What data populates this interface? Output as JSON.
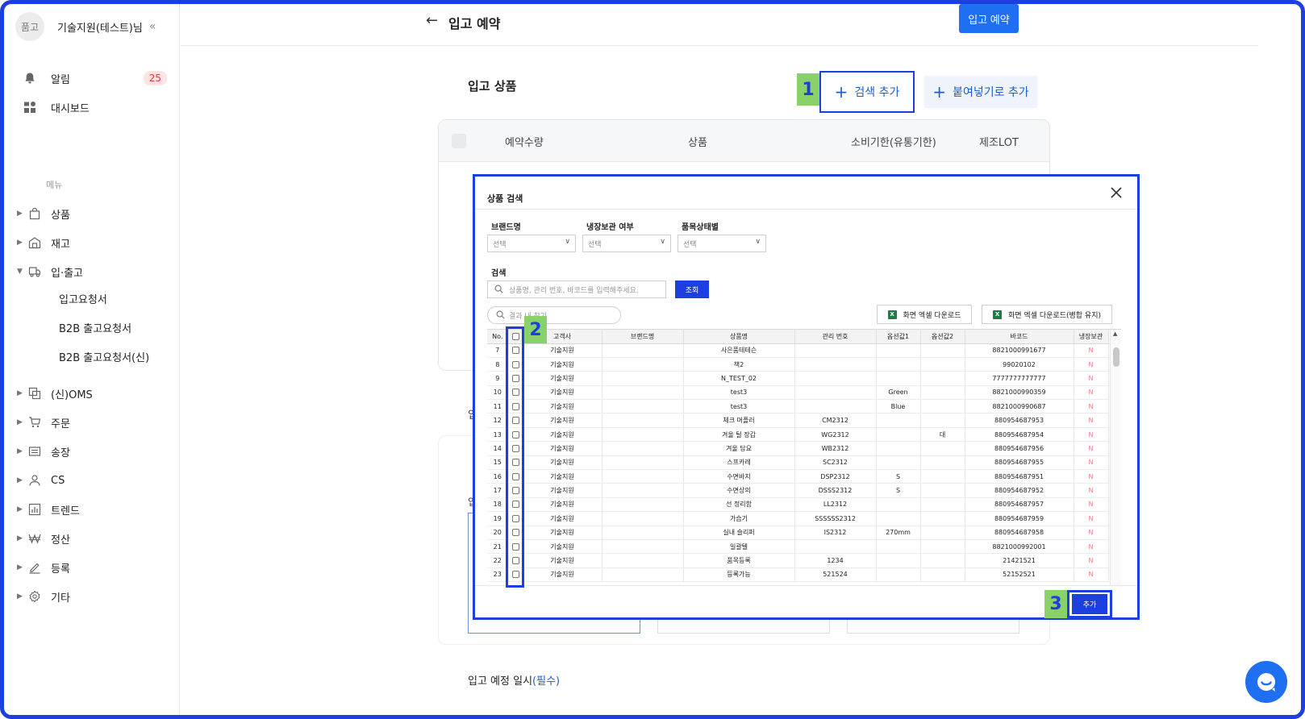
{
  "sidebar": {
    "avatar": "품고",
    "user_name": "기술지원(테스트)님",
    "collapse": "«",
    "top_items": [
      {
        "label": "알림",
        "icon": "bell-icon",
        "badge": "25"
      },
      {
        "label": "대시보드",
        "icon": "dashboard-icon"
      }
    ],
    "menu_label": "메뉴",
    "menu": [
      {
        "label": "상품",
        "icon": "bag-icon"
      },
      {
        "label": "재고",
        "icon": "warehouse-icon"
      },
      {
        "label": "입·출고",
        "icon": "truck-icon"
      },
      {
        "label": "(신)OMS",
        "icon": "oms-icon"
      },
      {
        "label": "주문",
        "icon": "cart-icon"
      },
      {
        "label": "송장",
        "icon": "invoice-icon"
      },
      {
        "label": "CS",
        "icon": "person-icon"
      },
      {
        "label": "트렌드",
        "icon": "chart-icon"
      },
      {
        "label": "정산",
        "icon": "won-icon"
      },
      {
        "label": "등록",
        "icon": "pen-icon"
      },
      {
        "label": "기타",
        "icon": "gear-icon"
      }
    ],
    "sub_items": [
      "입고요청서",
      "B2B 출고요청서",
      "B2B 출고요청서(신)"
    ]
  },
  "header": {
    "back": "←",
    "title": "입고 예약",
    "primary_button": "입고 예약"
  },
  "main": {
    "section_title": "입고 상품",
    "search_add": "검색 추가",
    "paste_add": "붙여넣기로 추가",
    "plus": "+",
    "table_headers": [
      "예약수량",
      "상품",
      "소비기한(유통기한)",
      "제조LOT"
    ],
    "bg_fragment_1": "입",
    "bg_fragment_2": "입",
    "due_label": "입고 예정 일시",
    "due_required": "(필수)"
  },
  "annotations": [
    "1",
    "2",
    "3"
  ],
  "modal": {
    "title": "상품 검색",
    "filters": [
      {
        "label": "브랜드명",
        "placeholder": "선택"
      },
      {
        "label": "냉장보관 여부",
        "placeholder": "선택"
      },
      {
        "label": "품목상태별",
        "placeholder": "선택"
      }
    ],
    "search_label": "검색",
    "search_placeholder": "상품명, 관리 번호, 바코드를 입력해주세요.",
    "query_button": "조회",
    "result_filter_placeholder": "결과 내 찾기",
    "excel_download": "화면 엑셀 다운로드",
    "excel_download_merged": "화면 엑셀 다운로드(병합 유지)",
    "excel_icon": "X",
    "columns": [
      "No.",
      "",
      "고객사",
      "브랜드명",
      "상품명",
      "관리 번호",
      "옵션값1",
      "옵션값2",
      "바코드",
      "냉장보관"
    ],
    "rows": [
      {
        "no": "7",
        "client": "기술지원",
        "brand": "",
        "name": "사은품테테슨",
        "code": "",
        "opt1": "",
        "opt2": "",
        "barcode": "8821000991677",
        "cold": "N"
      },
      {
        "no": "8",
        "client": "기술지원",
        "brand": "",
        "name": "책2",
        "code": "",
        "opt1": "",
        "opt2": "",
        "barcode": "99020102",
        "cold": "N"
      },
      {
        "no": "9",
        "client": "기술지원",
        "brand": "",
        "name": "N_TEST_02",
        "code": "",
        "opt1": "",
        "opt2": "",
        "barcode": "7777777777777",
        "cold": "N"
      },
      {
        "no": "10",
        "client": "기술지원",
        "brand": "",
        "name": "test3",
        "code": "",
        "opt1": "Green",
        "opt2": "",
        "barcode": "8821000990359",
        "cold": "N"
      },
      {
        "no": "11",
        "client": "기술지원",
        "brand": "",
        "name": "test3",
        "code": "",
        "opt1": "Blue",
        "opt2": "",
        "barcode": "8821000990687",
        "cold": "N"
      },
      {
        "no": "12",
        "client": "기술지원",
        "brand": "",
        "name": "체크 머플러",
        "code": "CM2312",
        "opt1": "",
        "opt2": "",
        "barcode": "880954687953",
        "cold": "N"
      },
      {
        "no": "13",
        "client": "기술지원",
        "brand": "",
        "name": "겨울 털 장갑",
        "code": "WG2312",
        "opt1": "",
        "opt2": "대",
        "barcode": "880954687954",
        "cold": "N"
      },
      {
        "no": "14",
        "client": "기술지원",
        "brand": "",
        "name": "겨울 담요",
        "code": "WB2312",
        "opt1": "",
        "opt2": "",
        "barcode": "880954687956",
        "cold": "N"
      },
      {
        "no": "15",
        "client": "기술지원",
        "brand": "",
        "name": "스프카레",
        "code": "SC2312",
        "opt1": "",
        "opt2": "",
        "barcode": "880954687955",
        "cold": "N"
      },
      {
        "no": "16",
        "client": "기술지원",
        "brand": "",
        "name": "수면바지",
        "code": "DSP2312",
        "opt1": "S",
        "opt2": "",
        "barcode": "880954687951",
        "cold": "N"
      },
      {
        "no": "17",
        "client": "기술지원",
        "brand": "",
        "name": "수면상의",
        "code": "DSSS2312",
        "opt1": "S",
        "opt2": "",
        "barcode": "880954687952",
        "cold": "N"
      },
      {
        "no": "18",
        "client": "기술지원",
        "brand": "",
        "name": "선 정리함",
        "code": "LL2312",
        "opt1": "",
        "opt2": "",
        "barcode": "880954687957",
        "cold": "N"
      },
      {
        "no": "19",
        "client": "기술지원",
        "brand": "",
        "name": "가습기",
        "code": "SSSSSS2312",
        "opt1": "",
        "opt2": "",
        "barcode": "880954687959",
        "cold": "N"
      },
      {
        "no": "20",
        "client": "기술지원",
        "brand": "",
        "name": "실내 슬리퍼",
        "code": "IS2312",
        "opt1": "270mm",
        "opt2": "",
        "barcode": "880954687958",
        "cold": "N"
      },
      {
        "no": "21",
        "client": "기술지원",
        "brand": "",
        "name": "일괄텔",
        "code": "",
        "opt1": "",
        "opt2": "",
        "barcode": "8821000992001",
        "cold": "N"
      },
      {
        "no": "22",
        "client": "기술지원",
        "brand": "",
        "name": "품목등록",
        "code": "1234",
        "opt1": "",
        "opt2": "",
        "barcode": "21421521",
        "cold": "N"
      },
      {
        "no": "23",
        "client": "기술지원",
        "brand": "",
        "name": "등록가능",
        "code": "521524",
        "opt1": "",
        "opt2": "",
        "barcode": "52152521",
        "cold": "N"
      }
    ],
    "add_button": "추가"
  },
  "colors": {
    "accent": "#1f6ff2",
    "highlight": "#1d3fe0",
    "label_bg": "#8ad16a",
    "badge": "#e23b3b"
  }
}
